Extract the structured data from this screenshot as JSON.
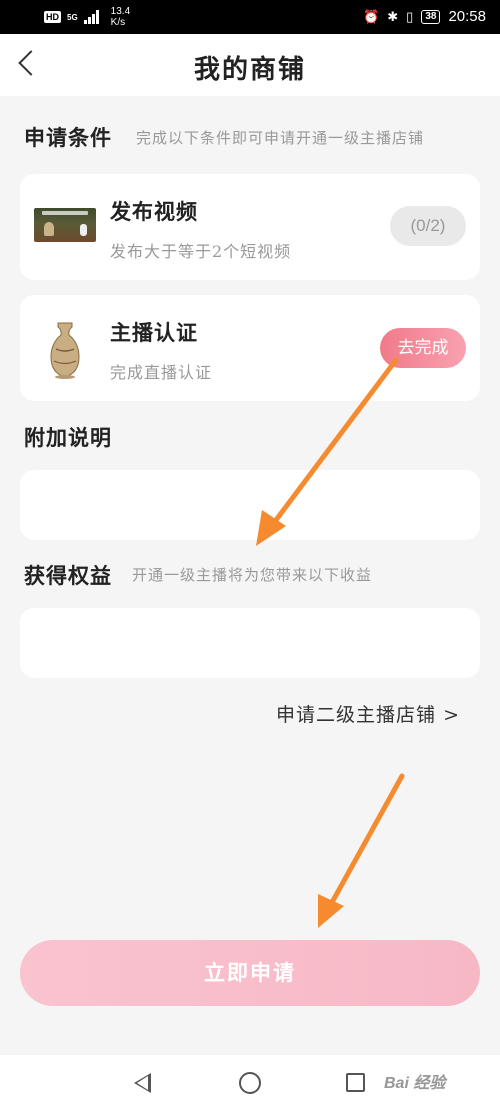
{
  "status_bar": {
    "hd": "HD",
    "network": "5G",
    "speed_value": "13.4",
    "speed_unit": "K/s",
    "battery": "38",
    "time": "20:58"
  },
  "header": {
    "title": "我的商铺"
  },
  "conditions": {
    "title": "申请条件",
    "subtitle": "完成以下条件即可申请开通一级主播店铺",
    "items": [
      {
        "title": "发布视频",
        "desc": "发布大于等于2个短视频",
        "status": "(0/2)"
      },
      {
        "title": "主播认证",
        "desc": "完成直播认证",
        "status": "去完成"
      }
    ]
  },
  "additional": {
    "title": "附加说明"
  },
  "benefits": {
    "title": "获得权益",
    "subtitle": "开通一级主播将为您带来以下收益"
  },
  "links": {
    "second_level": "申请二级主播店铺 >"
  },
  "actions": {
    "apply_label": "立即申请"
  },
  "watermark": "Bai 经验",
  "colors": {
    "accent_pink": "#f07a8a",
    "apply_button": "#f9c3cf",
    "annotation_arrow": "#f58a2e",
    "background": "#f5f5f5"
  }
}
